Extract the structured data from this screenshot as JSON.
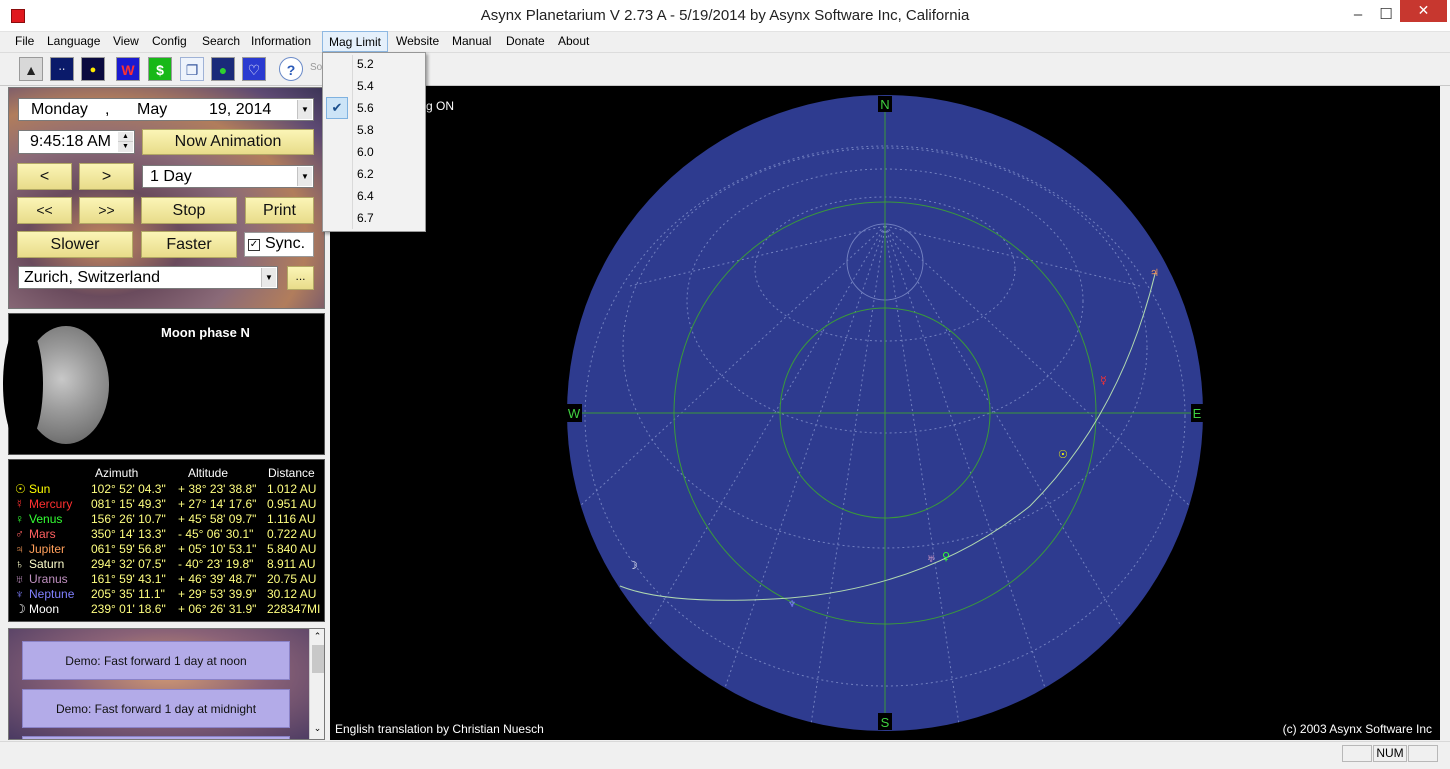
{
  "window": {
    "title": "Asynx Planetarium V 2.73 A - 5/19/2014 by Asynx Software Inc, California",
    "min_label": "–",
    "max_label": "☐",
    "close_label": "✕"
  },
  "menu": {
    "items": [
      "File",
      "Language",
      "View",
      "Config",
      "Search",
      "Information",
      "Mag Limit",
      "Website",
      "Manual",
      "Donate",
      "About"
    ],
    "open": "Mag Limit"
  },
  "mag_limit": {
    "options": [
      "5.2",
      "5.4",
      "5.6",
      "5.8",
      "6.0",
      "6.2",
      "6.4",
      "6.7"
    ],
    "selected": "5.6",
    "check_glyph": "✔"
  },
  "toolbar": {
    "buttons": [
      "sky-view-icon",
      "constellation-icon",
      "planets-icon",
      "website-icon",
      "donate-icon",
      "copy-icon",
      "globe-icon",
      "logo-icon",
      "help-icon"
    ],
    "watermark": "Softpedia.com"
  },
  "controls": {
    "date": {
      "weekday": "Monday",
      "sep": ",",
      "month": "May",
      "day_year": "19, 2014"
    },
    "time": "9:45:18 AM",
    "now_animation": "Now Animation",
    "prev": "<",
    "next": ">",
    "step": "1 Day",
    "fast_back": "<<",
    "fast_fwd": ">>",
    "stop": "Stop",
    "print": "Print",
    "slower": "Slower",
    "faster": "Faster",
    "sync": "Sync.",
    "sync_checked": true,
    "location": "Zurich, Switzerland",
    "location_more": "..."
  },
  "moon": {
    "label": "Moon phase  N"
  },
  "planets": {
    "headers": {
      "azimuth": "Azimuth",
      "altitude": "Altitude",
      "distance": "Distance"
    },
    "rows": [
      {
        "symbol": "☉",
        "name": "Sun",
        "color": "#ffff00",
        "azimuth": "102° 52' 04.3\"",
        "altitude": "+ 38° 23' 38.8\"",
        "distance": "1.012 AU"
      },
      {
        "symbol": "☿",
        "name": "Mercury",
        "color": "#ff3030",
        "azimuth": "081° 15' 49.3\"",
        "altitude": "+ 27° 14' 17.6\"",
        "distance": "0.951 AU"
      },
      {
        "symbol": "♀",
        "name": "Venus",
        "color": "#33ff33",
        "azimuth": "156° 26' 10.7\"",
        "altitude": "+ 45° 58' 09.7\"",
        "distance": "1.116 AU"
      },
      {
        "symbol": "♂",
        "name": "Mars",
        "color": "#ff6060",
        "azimuth": "350° 14' 13.3\"",
        "altitude": "-  45° 06' 30.1\"",
        "distance": "0.722 AU"
      },
      {
        "symbol": "♃",
        "name": "Jupiter",
        "color": "#ff9f5a",
        "azimuth": "061° 59' 56.8\"",
        "altitude": "+ 05° 10' 53.1\"",
        "distance": "5.840 AU"
      },
      {
        "symbol": "♄",
        "name": "Saturn",
        "color": "#ffffcc",
        "azimuth": "294° 32' 07.5\"",
        "altitude": "-  40° 23' 19.8\"",
        "distance": "8.911 AU"
      },
      {
        "symbol": "♅",
        "name": "Uranus",
        "color": "#c090c0",
        "azimuth": "161° 59' 43.1\"",
        "altitude": "+ 46° 39' 48.7\"",
        "distance": "20.75 AU"
      },
      {
        "symbol": "♆",
        "name": "Neptune",
        "color": "#8080ff",
        "azimuth": "205° 35' 11.1\"",
        "altitude": "+ 29° 53' 39.9\"",
        "distance": "30.12 AU"
      },
      {
        "symbol": "☽",
        "name": "Moon",
        "color": "#ffffff",
        "azimuth": "239° 01' 18.6\"",
        "altitude": "+ 06° 26' 31.9\"",
        "distance": "228347MI"
      }
    ]
  },
  "demos": [
    "Demo: Fast forward 1 day at noon",
    "Demo: Fast forward 1 day at midnight"
  ],
  "sky": {
    "status_text": "g ON",
    "directions": {
      "north": "N",
      "south": "S",
      "east": "E",
      "west": "W"
    },
    "credit_left": "English translation by Christian Nuesch",
    "credit_right": "(c) 2003 Asynx Software Inc",
    "colors": {
      "dome": "#2e3b8f",
      "grid": "#7280c0",
      "horizon": "#3a9a3a",
      "ecliptic": "#b0d8b0"
    }
  },
  "statusbar": {
    "num": "NUM"
  }
}
